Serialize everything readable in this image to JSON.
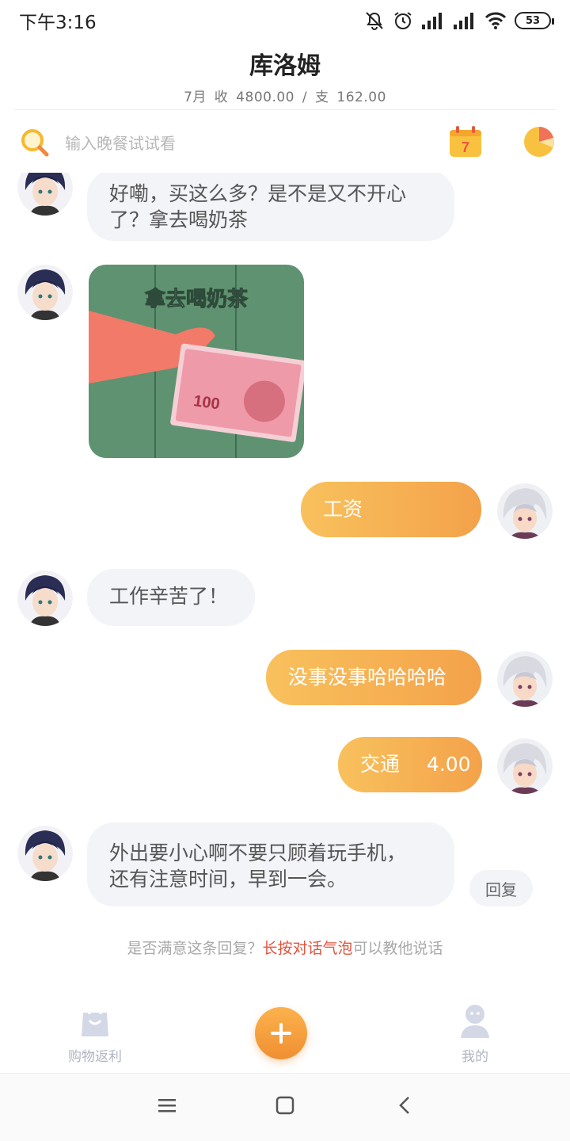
{
  "status_bar": {
    "time": "下午3:16",
    "battery": "53"
  },
  "header": {
    "title": "库洛姆",
    "summary": "7月 收 4800.00 / 支 162.00"
  },
  "search": {
    "placeholder": "输入晚餐试试看",
    "calendar_day": "7"
  },
  "messages": [
    {
      "side": "in",
      "text_lines": [
        "好嘞，买这么多？是不是又不开心",
        "了？拿去喝奶茶"
      ]
    },
    {
      "side": "in",
      "type": "sticker",
      "sticker_text": "拿去喝奶茶",
      "note_value": "100"
    },
    {
      "side": "out",
      "text": "工资"
    },
    {
      "side": "in",
      "text": "工作辛苦了！"
    },
    {
      "side": "out",
      "text": "没事没事哈哈哈哈"
    },
    {
      "side": "out",
      "category": "交通",
      "amount": "4.00"
    },
    {
      "side": "in",
      "text_lines": [
        "外出要小心啊不要只顾着玩手机，",
        "还有注意时间，早到一会。"
      ]
    }
  ],
  "reply_button": "回复",
  "hint": {
    "before": "是否满意这条回复？",
    "highlight": "长按对话气泡",
    "after": "可以教他说话"
  },
  "bottom_nav": {
    "shop_label": "购物返利",
    "mine_label": "我的"
  },
  "colors": {
    "accent": "#f5a94a",
    "highlight": "#e2533d",
    "bubble_in": "#f3f4f8"
  },
  "icons": [
    "mute-icon",
    "alarm-icon",
    "signal-icon",
    "wifi-icon",
    "search-icon",
    "calendar-icon",
    "pie-chart-icon",
    "shopping-bag-icon",
    "plus-icon",
    "user-icon",
    "menu-icon",
    "home-icon",
    "back-icon"
  ]
}
